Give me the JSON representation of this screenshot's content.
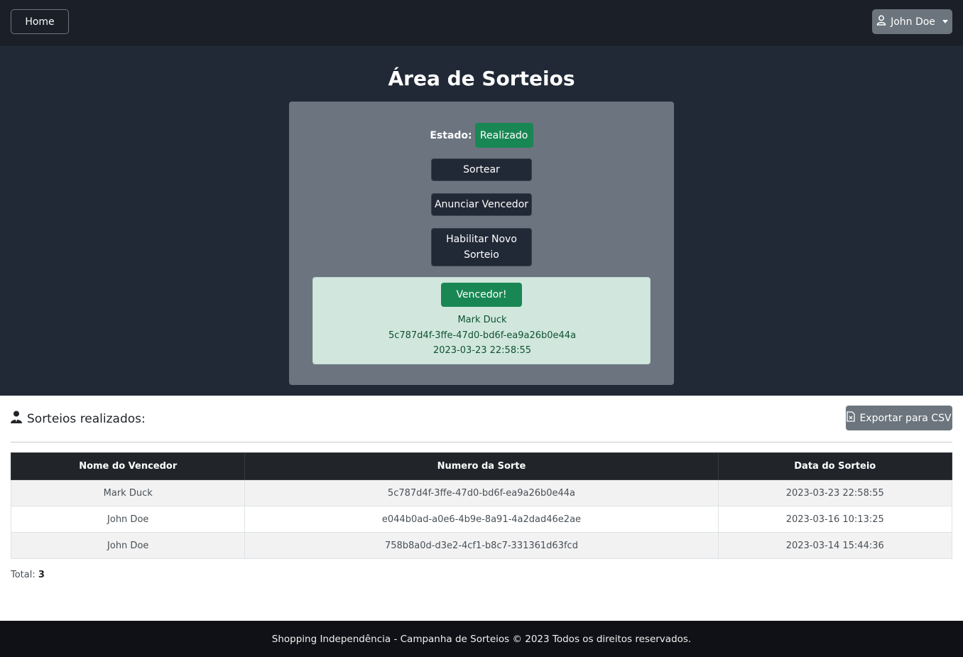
{
  "nav": {
    "home_label": "Home",
    "user_name": "John Doe"
  },
  "hero": {
    "title": "Área de Sorteios",
    "estado_label": "Estado:",
    "estado_value": "Realizado",
    "sortear_label": "Sortear",
    "anunciar_label": "Anunciar Vencedor",
    "habilitar_label_1": "Habilitar Novo",
    "habilitar_label_2": "Sorteio",
    "winner": {
      "button_label": "Vencedor!",
      "name": "Mark Duck",
      "code": "5c787d4f-3ffe-47d0-bd6f-ea9a26b0e44a",
      "date": "2023-03-23 22:58:55"
    }
  },
  "results": {
    "title": "Sorteios realizados:",
    "export_label": "Exportar para CSV",
    "columns": [
      "Nome do Vencedor",
      "Numero da Sorte",
      "Data do Sorteio"
    ],
    "rows": [
      [
        "Mark Duck",
        "5c787d4f-3ffe-47d0-bd6f-ea9a26b0e44a",
        "2023-03-23 22:58:55"
      ],
      [
        "John Doe",
        "e044b0ad-a0e6-4b9e-8a91-4a2dad46e2ae",
        "2023-03-16 10:13:25"
      ],
      [
        "John Doe",
        "758b8a0d-d3e2-4cf1-b8c7-331361d63fcd",
        "2023-03-14 15:44:36"
      ]
    ],
    "total_label": "Total:",
    "total_value": "3"
  },
  "footer": {
    "text": "Shopping Independência - Campanha de Sorteios © 2023 Todos os direitos reservados."
  },
  "colors": {
    "success": "#198754",
    "dark": "#212936",
    "secondary": "#6c757d"
  },
  "icons": {
    "user_menu": "user-outline-icon",
    "section": "user-tie-icon",
    "export": "file-csv-icon"
  }
}
